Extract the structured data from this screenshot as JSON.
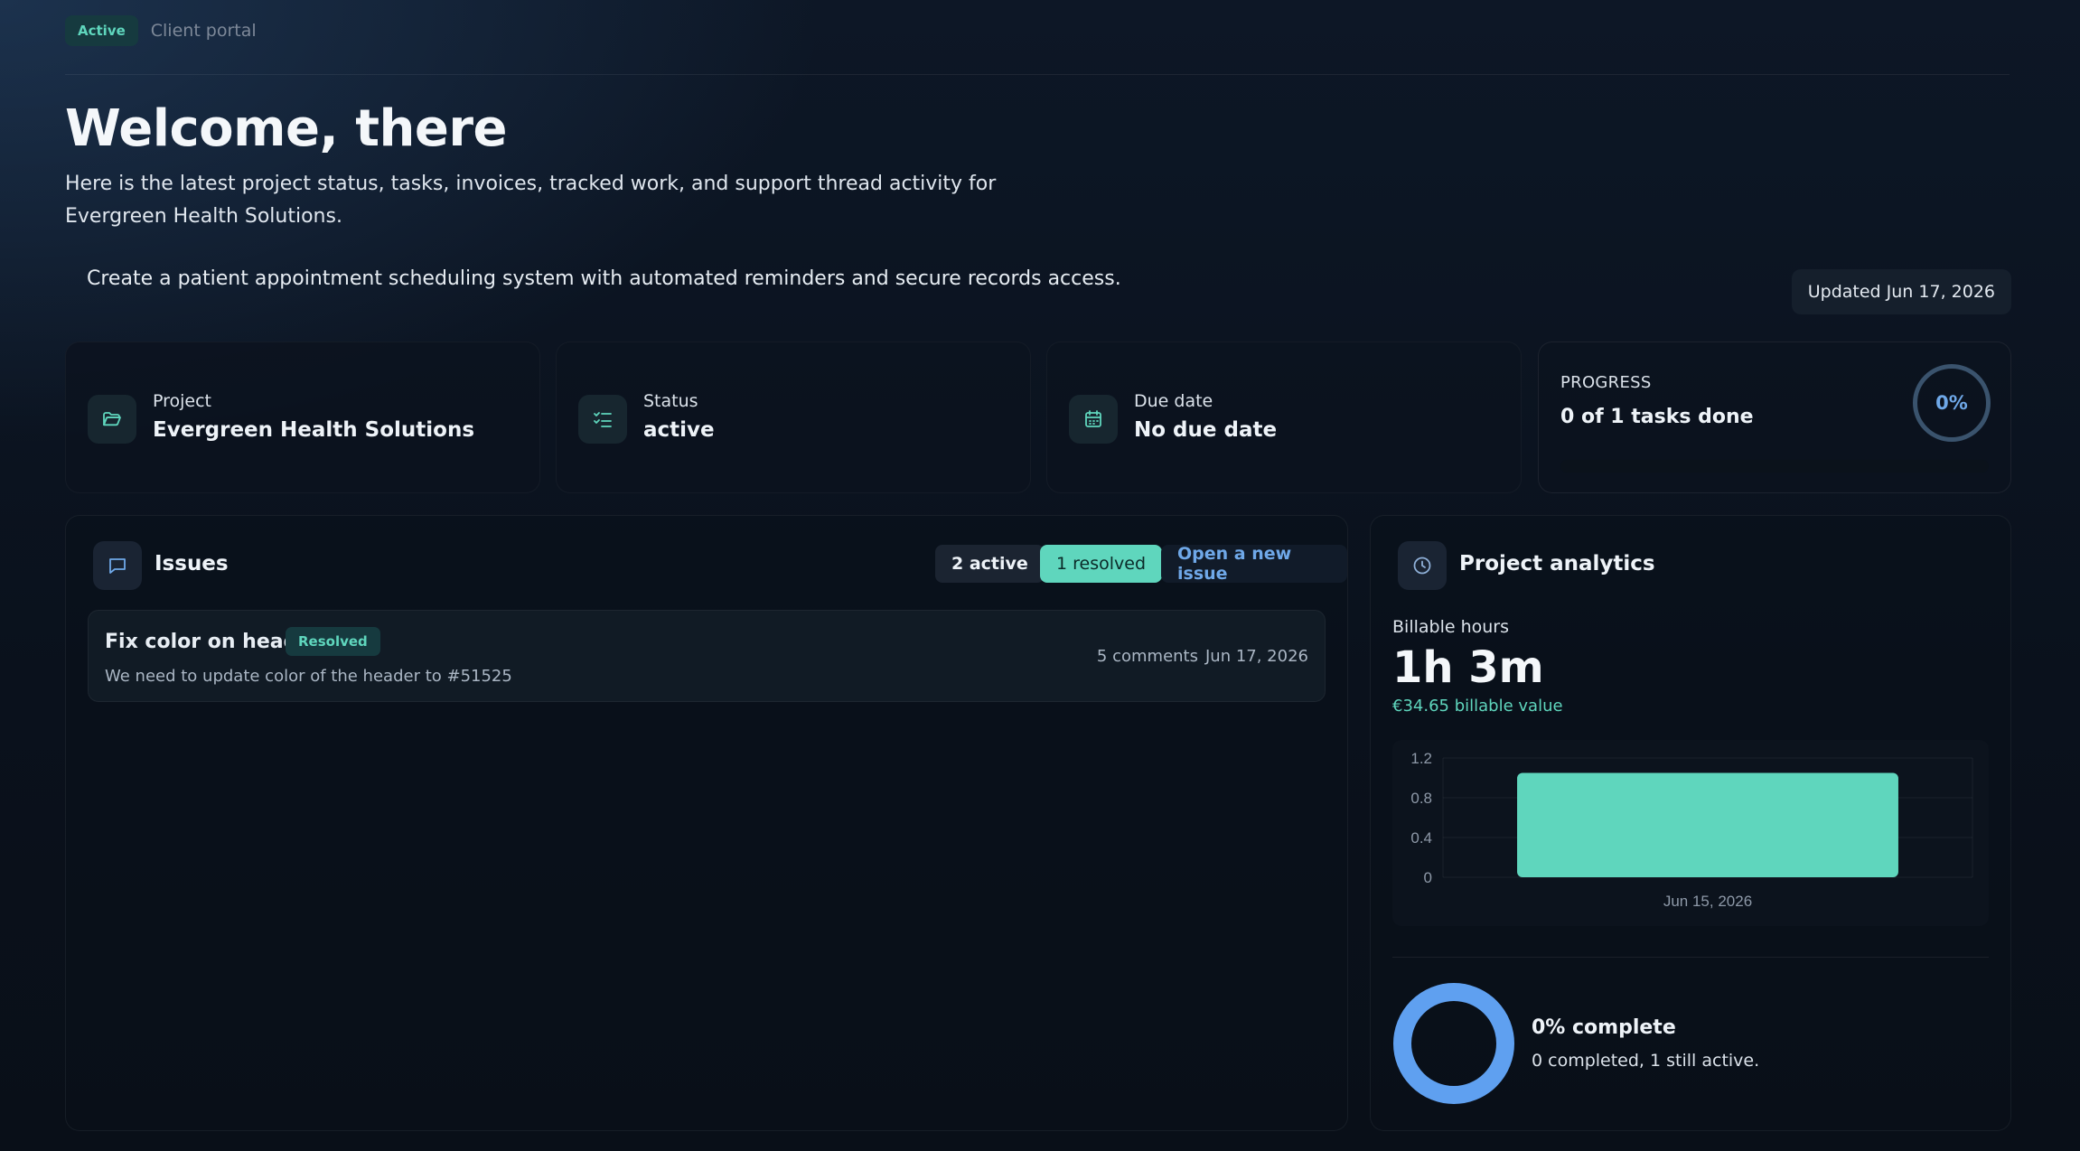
{
  "header": {
    "badge": "Active",
    "portal_label": "Client portal",
    "title": "Welcome, there",
    "subtitle": "Here is the latest project status, tasks, invoices, tracked work, and support thread activity for Evergreen Health Solutions.",
    "description": "Create a patient appointment scheduling system with automated reminders and secure records access.",
    "updated": "Updated Jun 17, 2026"
  },
  "cards": {
    "project": {
      "label": "Project",
      "value": "Evergreen Health Solutions",
      "icon": "folder-icon"
    },
    "status": {
      "label": "Status",
      "value": "active",
      "icon": "checklist-icon"
    },
    "due": {
      "label": "Due date",
      "value": "No due date",
      "icon": "calendar-icon"
    },
    "progress": {
      "label": "PROGRESS",
      "value": "0 of 1 tasks done",
      "percent": "0%",
      "fraction": 0
    }
  },
  "issues": {
    "title": "Issues",
    "icon": "chat-icon",
    "active_label": "2 active",
    "resolved_label": "1 resolved",
    "open_label": "Open a new issue",
    "items": [
      {
        "title": "Fix color on header",
        "status": "Resolved",
        "description": "We need to update color of the header to #51525",
        "comments": "5 comments",
        "date": "Jun 17, 2026"
      }
    ]
  },
  "analytics": {
    "title": "Project analytics",
    "icon": "clock-icon",
    "billable_label": "Billable hours",
    "billable_value": "1h 3m",
    "billable_money": "€34.65 billable value",
    "completion_title": "0% complete",
    "completion_sub": "0 completed, 1 still active.",
    "completion_fraction": 0
  },
  "colors": {
    "accent": "#5fd6bd",
    "link": "#6fa8e8",
    "donut": "#5fa0f0"
  },
  "chart_data": {
    "type": "bar",
    "categories": [
      "Jun 15, 2026"
    ],
    "values": [
      1.05
    ],
    "yticks": [
      "1.2",
      "0.8",
      "0.4",
      "0"
    ],
    "ylim": [
      0,
      1.2
    ],
    "grid": true,
    "title": "",
    "xlabel": "",
    "ylabel": ""
  }
}
